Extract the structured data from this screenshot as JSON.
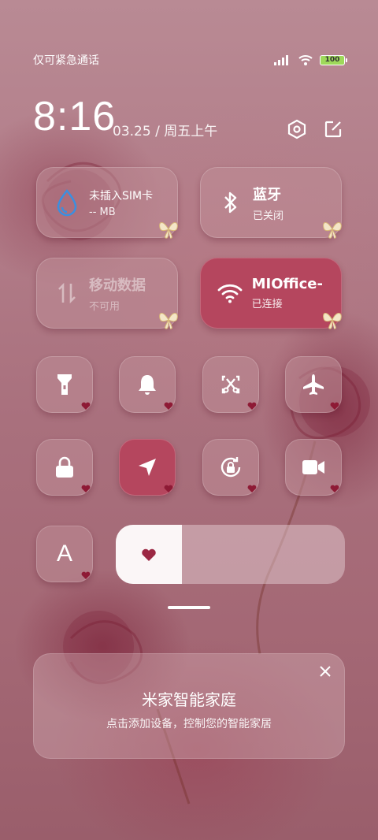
{
  "status_bar": {
    "carrier": "仅可紧急通话",
    "battery": "100"
  },
  "header": {
    "time": "8:16",
    "date": "03.25 / 周五上午",
    "settings_icon": "settings-hexagon-icon",
    "edit_icon": "edit-icon"
  },
  "tiles": [
    {
      "title": "未插入SIM卡",
      "sub": "-- MB",
      "icon": "water-drop-icon",
      "state": "normal"
    },
    {
      "title": "蓝牙",
      "sub": "已关闭",
      "icon": "bluetooth-icon",
      "state": "normal"
    },
    {
      "title": "移动数据",
      "sub": "不可用",
      "icon": "mobile-data-icon",
      "state": "disabled"
    },
    {
      "title": "MIOffice-",
      "sub": "已连接",
      "icon": "wifi-icon",
      "state": "active"
    }
  ],
  "toggles": [
    {
      "name": "flashlight",
      "icon": "flashlight-icon",
      "active": false
    },
    {
      "name": "ringer",
      "icon": "bell-icon",
      "active": false
    },
    {
      "name": "screenshot",
      "icon": "scissors-screenshot-icon",
      "active": false
    },
    {
      "name": "airplane-mode",
      "icon": "airplane-icon",
      "active": false
    },
    {
      "name": "lock-screen",
      "icon": "lock-icon",
      "active": false
    },
    {
      "name": "location",
      "icon": "location-arrow-icon",
      "active": true
    },
    {
      "name": "rotation-lock",
      "icon": "rotation-lock-icon",
      "active": false
    },
    {
      "name": "screen-record",
      "icon": "video-camera-icon",
      "active": false
    }
  ],
  "font_toggle": {
    "label": "A"
  },
  "brightness": {
    "level": 0.29
  },
  "smart_home": {
    "title": "米家智能家庭",
    "subtitle": "点击添加设备，控制您的智能家居"
  },
  "colors": {
    "accent": "#b5465e",
    "heart": "#8e1a35"
  }
}
